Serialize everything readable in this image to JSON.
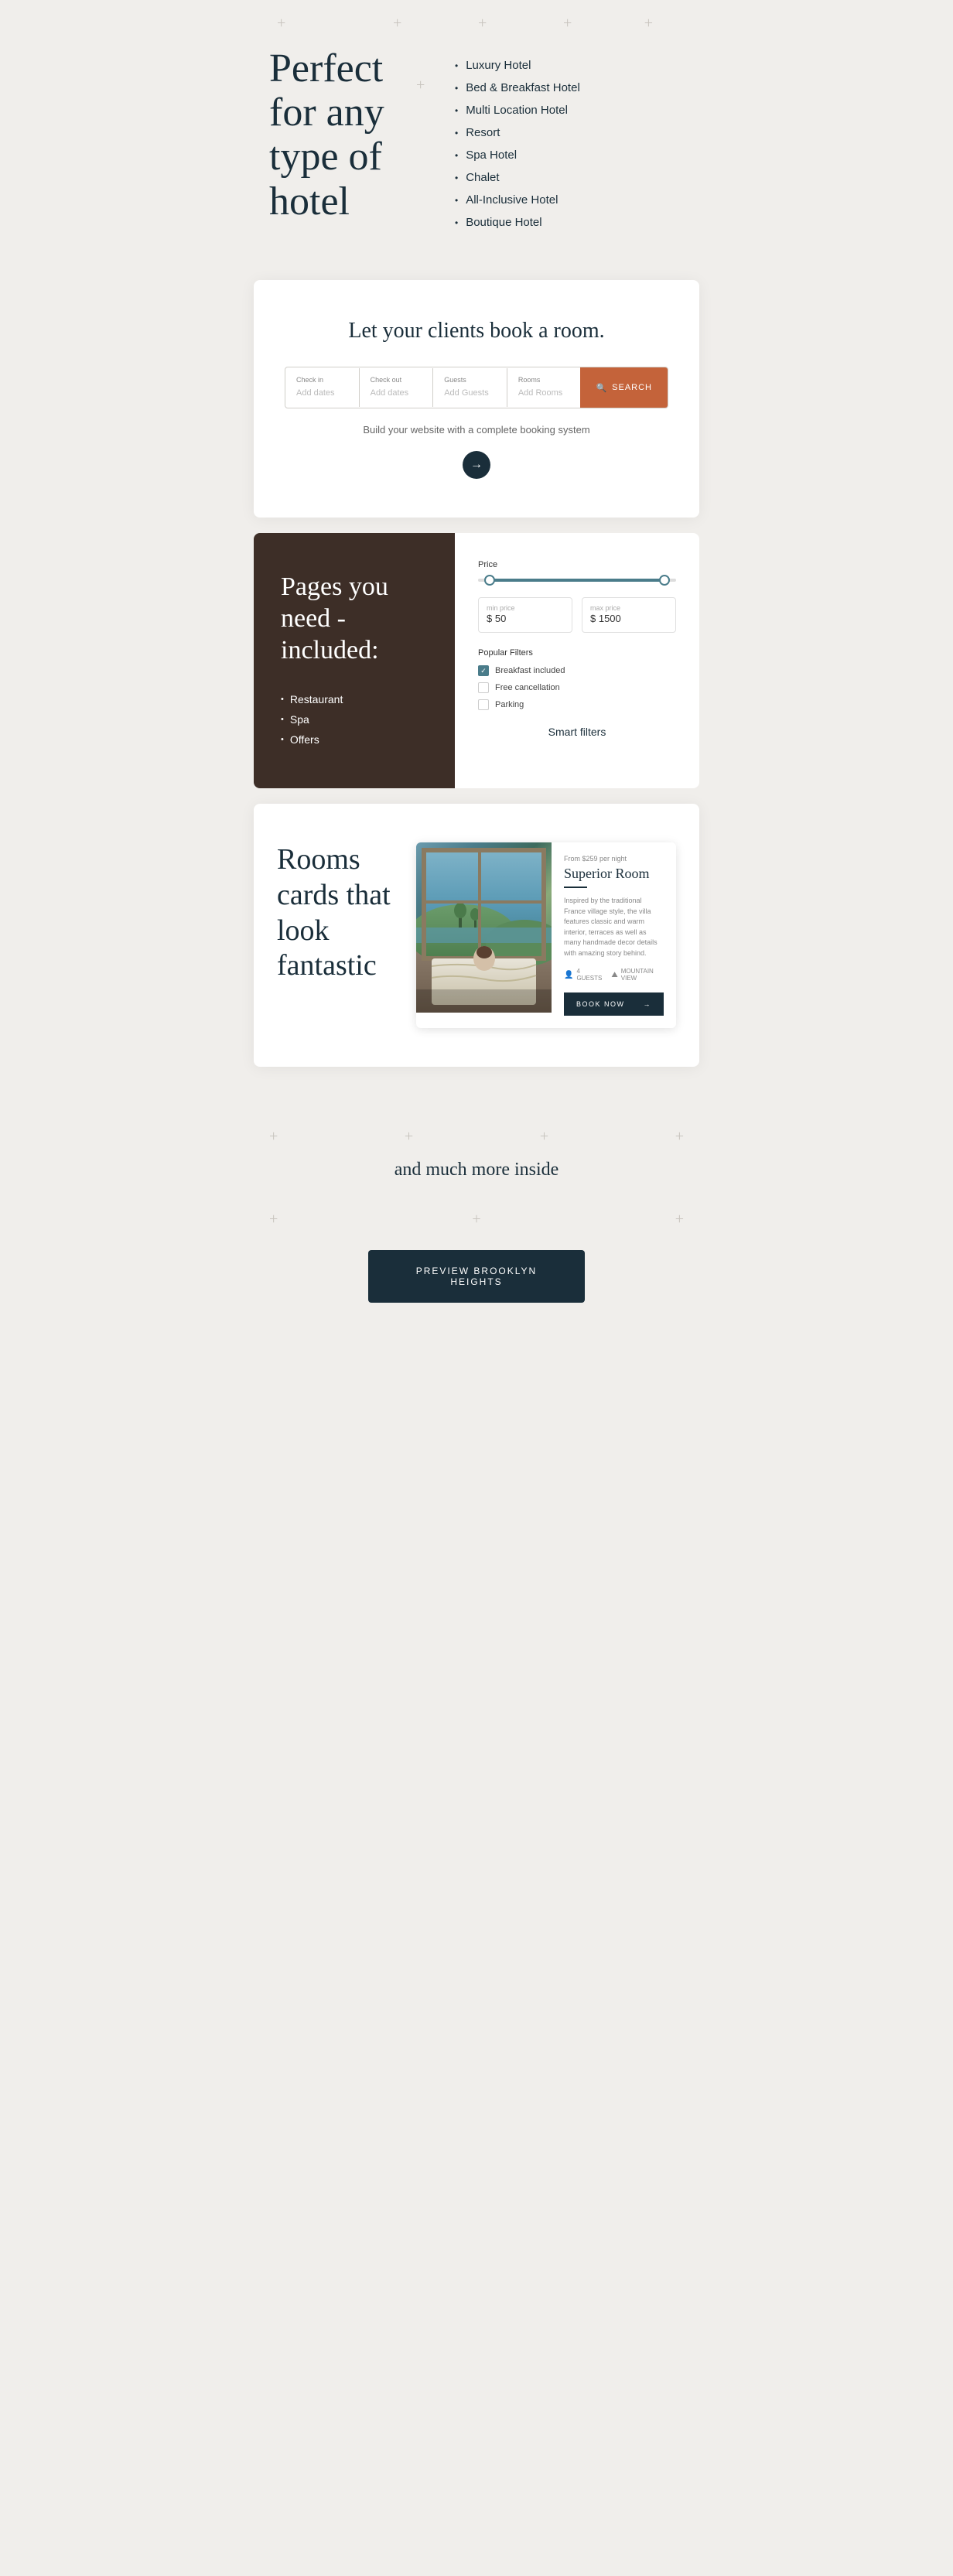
{
  "hero": {
    "title": "Perfect for any type of hotel",
    "hotel_types": [
      "Luxury Hotel",
      "Bed & Breakfast Hotel",
      "Multi Location Hotel",
      "Resort",
      "Spa Hotel",
      "Chalet",
      "All-Inclusive Hotel",
      "Boutique Hotel"
    ]
  },
  "booking": {
    "title": "Let your clients book a room.",
    "subtitle": "Build your website with a complete booking system",
    "fields": {
      "checkin_label": "Check in",
      "checkin_placeholder": "Add dates",
      "checkout_label": "Check out",
      "checkout_placeholder": "Add dates",
      "guests_label": "Guests",
      "guests_placeholder": "Add Guests",
      "rooms_label": "Rooms",
      "rooms_placeholder": "Add Rooms"
    },
    "search_button": "SEARCH"
  },
  "pages": {
    "title": "Pages you need - included:",
    "items": [
      "Restaurant",
      "Spa",
      "Offers"
    ]
  },
  "filters": {
    "price_label": "Price",
    "min_price_label": "min price",
    "min_price_value": "$ 50",
    "max_price_label": "max price",
    "max_price_value": "$ 1500",
    "popular_filters_label": "Popular Filters",
    "filter_items": [
      {
        "label": "Breakfast included",
        "checked": true
      },
      {
        "label": "Free cancellation",
        "checked": false
      },
      {
        "label": "Parking",
        "checked": false
      }
    ],
    "smart_filters_label": "Smart filters"
  },
  "rooms": {
    "title": "Rooms cards that look fantastic",
    "card": {
      "price_label": "From $259 per night",
      "room_name": "Superior Room",
      "description": "Inspired by the traditional France village style, the villa features classic and warm interior, terraces as well as many handmade decor details with amazing story behind.",
      "amenities": [
        {
          "icon": "person",
          "label": "4 GUESTS"
        },
        {
          "icon": "mountain",
          "label": "MOUNTAIN VIEW"
        }
      ],
      "book_button": "BOOK NOW"
    }
  },
  "more": {
    "title": "and much more inside",
    "preview_button": "PREVIEW BROOKLYN HEIGHTS"
  }
}
